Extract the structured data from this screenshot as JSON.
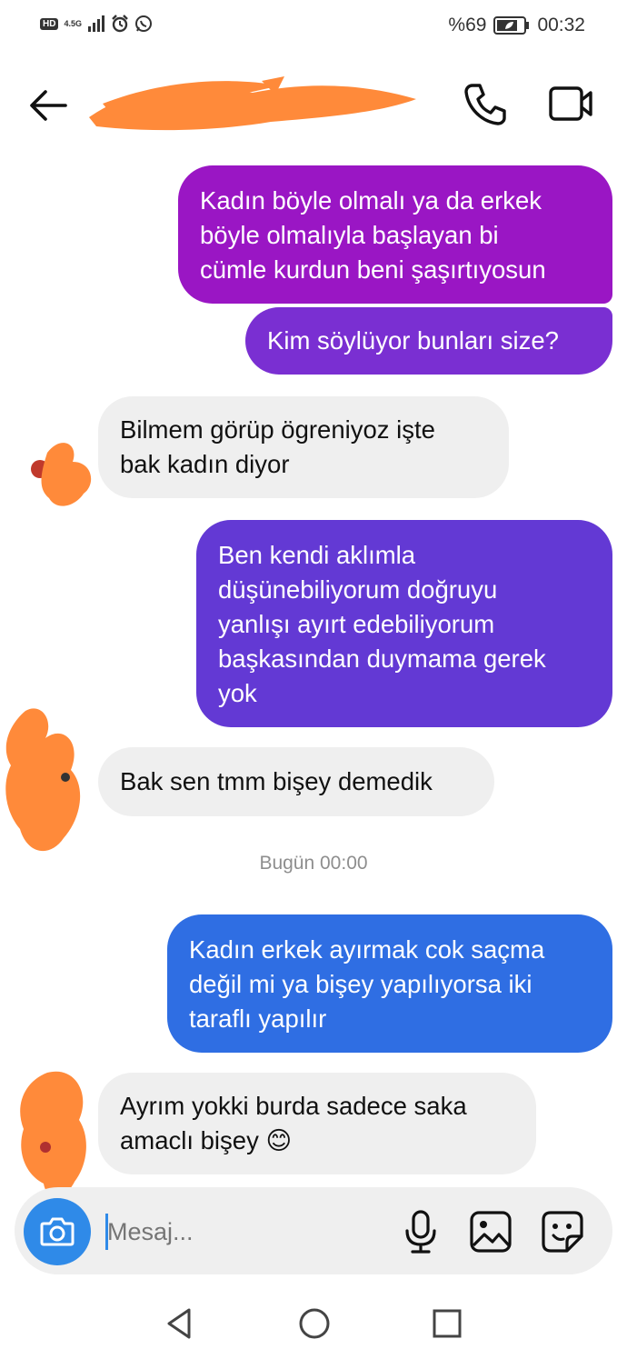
{
  "status_bar": {
    "hd": "HD",
    "network": "4.5G",
    "battery_text": "%69",
    "time": "00:32"
  },
  "header": {
    "contact_name": "",
    "back_icon": "arrow-left-icon",
    "call_icon": "phone-icon",
    "video_icon": "video-camera-icon"
  },
  "colors": {
    "bubble_1": "#9a16c4",
    "bubble_2": "#7a2fd2",
    "bubble_3": "#6339d4",
    "bubble_4": "#2f6ee3",
    "incoming_bubble": "#efefef",
    "scribble": "#ff8a3a",
    "camera_button": "#2f8ae8"
  },
  "messages": [
    {
      "direction": "out",
      "text": "Kadın böyle olmalı ya da erkek\nböyle olmalıyla başlayan bi\ncümle kurdun beni şaşırtıyosun"
    },
    {
      "direction": "out",
      "text": "Kim söylüyor bunları size?"
    },
    {
      "direction": "in",
      "text": "Bilmem görüp ögreniyoz işte\nbak kadın diyor"
    },
    {
      "direction": "out",
      "text": "Ben kendi aklımla\ndüşünebiliyorum doğruyu\nyanlışı ayırt edebiliyorum\nbaşkasından duymama gerek\nyok"
    },
    {
      "direction": "in",
      "text": "Bak sen tmm bişey demedik"
    },
    {
      "direction": "out",
      "text": "Kadın erkek ayırmak cok saçma\ndeğil mi ya bişey yapılıyorsa iki\ntaraflı yapılır"
    },
    {
      "direction": "in",
      "text": "Ayrım yokki burda sadece saka\namaclı bişey 😊"
    }
  ],
  "timestamp": "Bugün 00:00",
  "composer": {
    "placeholder": "Mesaj...",
    "camera_icon": "camera-icon",
    "mic_icon": "microphone-icon",
    "gallery_icon": "image-icon",
    "sticker_icon": "sticker-icon"
  },
  "nav": {
    "back_icon": "triangle-back-icon",
    "home_icon": "circle-home-icon",
    "recent_icon": "square-recent-icon"
  }
}
